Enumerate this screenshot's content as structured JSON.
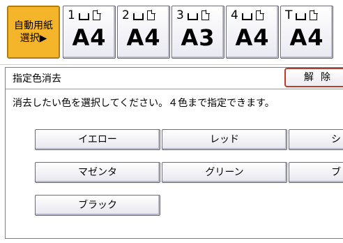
{
  "trays": {
    "auto": {
      "line1": "自動用紙",
      "line2": "選択▶"
    },
    "items": [
      {
        "num": "1",
        "size": "A4"
      },
      {
        "num": "2",
        "size": "A4"
      },
      {
        "num": "3",
        "size": "A3"
      },
      {
        "num": "4",
        "size": "A4"
      },
      {
        "num": "T",
        "size": "A4"
      }
    ]
  },
  "panel": {
    "title": "指定色消去",
    "release_label": "解除",
    "instruction": "消去したい色を選択してください。４色まで指定できます。",
    "colors": [
      "イエロー",
      "レッド",
      "シ",
      "マゼンタ",
      "グリーン",
      "ブ",
      "ブラック"
    ]
  }
}
